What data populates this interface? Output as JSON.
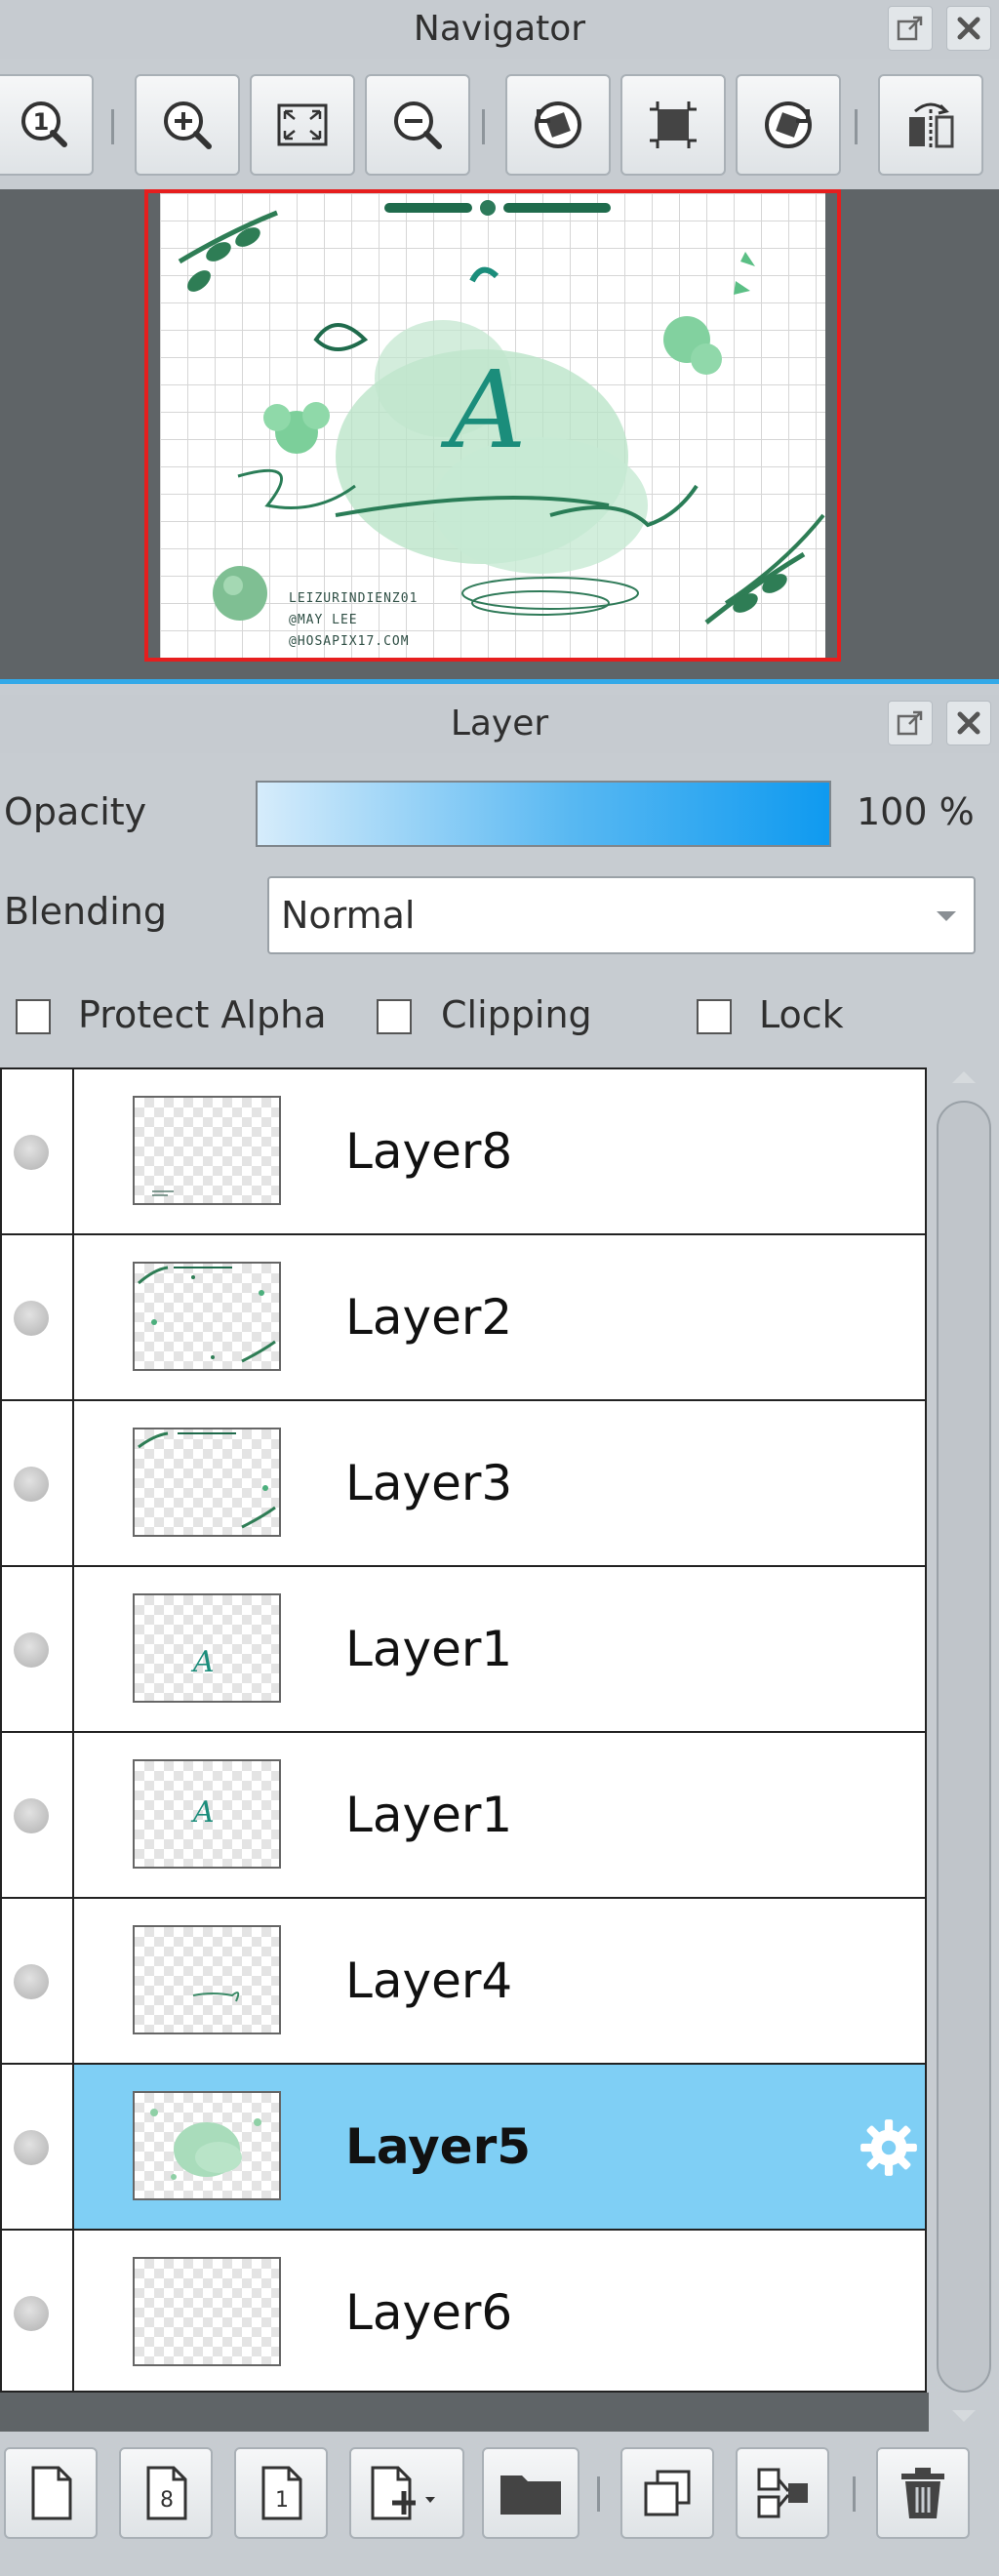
{
  "navigator": {
    "title": "Navigator",
    "toolbar_icons": [
      "zoom-actual-size-icon",
      "zoom-in-icon",
      "fit-to-window-icon",
      "zoom-out-icon",
      "rotate-left-icon",
      "reset-view-icon",
      "rotate-right-icon",
      "flip-horizontal-icon"
    ],
    "canvas_credits": [
      "LEIZURINDIENZ01",
      "@MAY LEE",
      "@HOSAPIX17.COM"
    ]
  },
  "layer_panel": {
    "title": "Layer",
    "opacity": {
      "label": "Opacity",
      "value_text": "100 %",
      "value": 100
    },
    "blending": {
      "label": "Blending",
      "value": "Normal"
    },
    "options": {
      "protect_alpha": {
        "label": "Protect Alpha",
        "checked": false
      },
      "clipping": {
        "label": "Clipping",
        "checked": false
      },
      "lock": {
        "label": "Lock",
        "checked": false
      }
    },
    "layers": [
      {
        "name": "Layer8",
        "selected": false
      },
      {
        "name": "Layer2",
        "selected": false
      },
      {
        "name": "Layer3",
        "selected": false
      },
      {
        "name": "Layer1",
        "selected": false
      },
      {
        "name": "Layer1",
        "selected": false
      },
      {
        "name": "Layer4",
        "selected": false
      },
      {
        "name": "Layer5",
        "selected": true
      },
      {
        "name": "Layer6",
        "selected": false
      }
    ],
    "bottom_toolbar_icons": [
      "new-layer-icon",
      "new-8bit-layer-icon",
      "new-1bit-layer-icon",
      "add-layer-menu-icon",
      "new-folder-icon",
      "duplicate-layer-icon",
      "merge-down-icon",
      "delete-layer-icon"
    ],
    "colors": {
      "selected_row": "#7fcff5",
      "accent": "#33a9e8",
      "opacity_fill": "#0f9af0",
      "navigator_frame": "#e61e1e"
    }
  }
}
